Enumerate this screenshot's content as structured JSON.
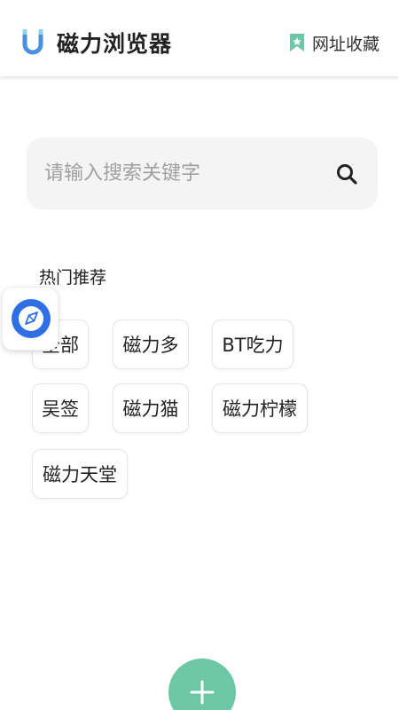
{
  "header": {
    "app_name": "磁力浏览器",
    "bookmarks_label": "网址收藏",
    "logo_icon": "magnet-icon",
    "bookmark_icon": "bookmark-icon"
  },
  "search": {
    "placeholder": "请输入搜索关键字",
    "value": "",
    "icon": "search-icon"
  },
  "hot": {
    "title": "热门推荐",
    "items": [
      "全部",
      "磁力多",
      "BT吃力",
      "吴签",
      "磁力猫",
      "磁力柠檬",
      "磁力天堂"
    ]
  },
  "floating_button": {
    "icon": "compass-icon"
  },
  "add_button": {
    "icon": "plus-icon"
  },
  "colors": {
    "accent_green": "#6cc7a6",
    "logo_blue": "#4a90e2",
    "logo_tips": "#8fd1ea",
    "compass_blue": "#2f6fe4",
    "search_bg": "#f4f4f5"
  }
}
